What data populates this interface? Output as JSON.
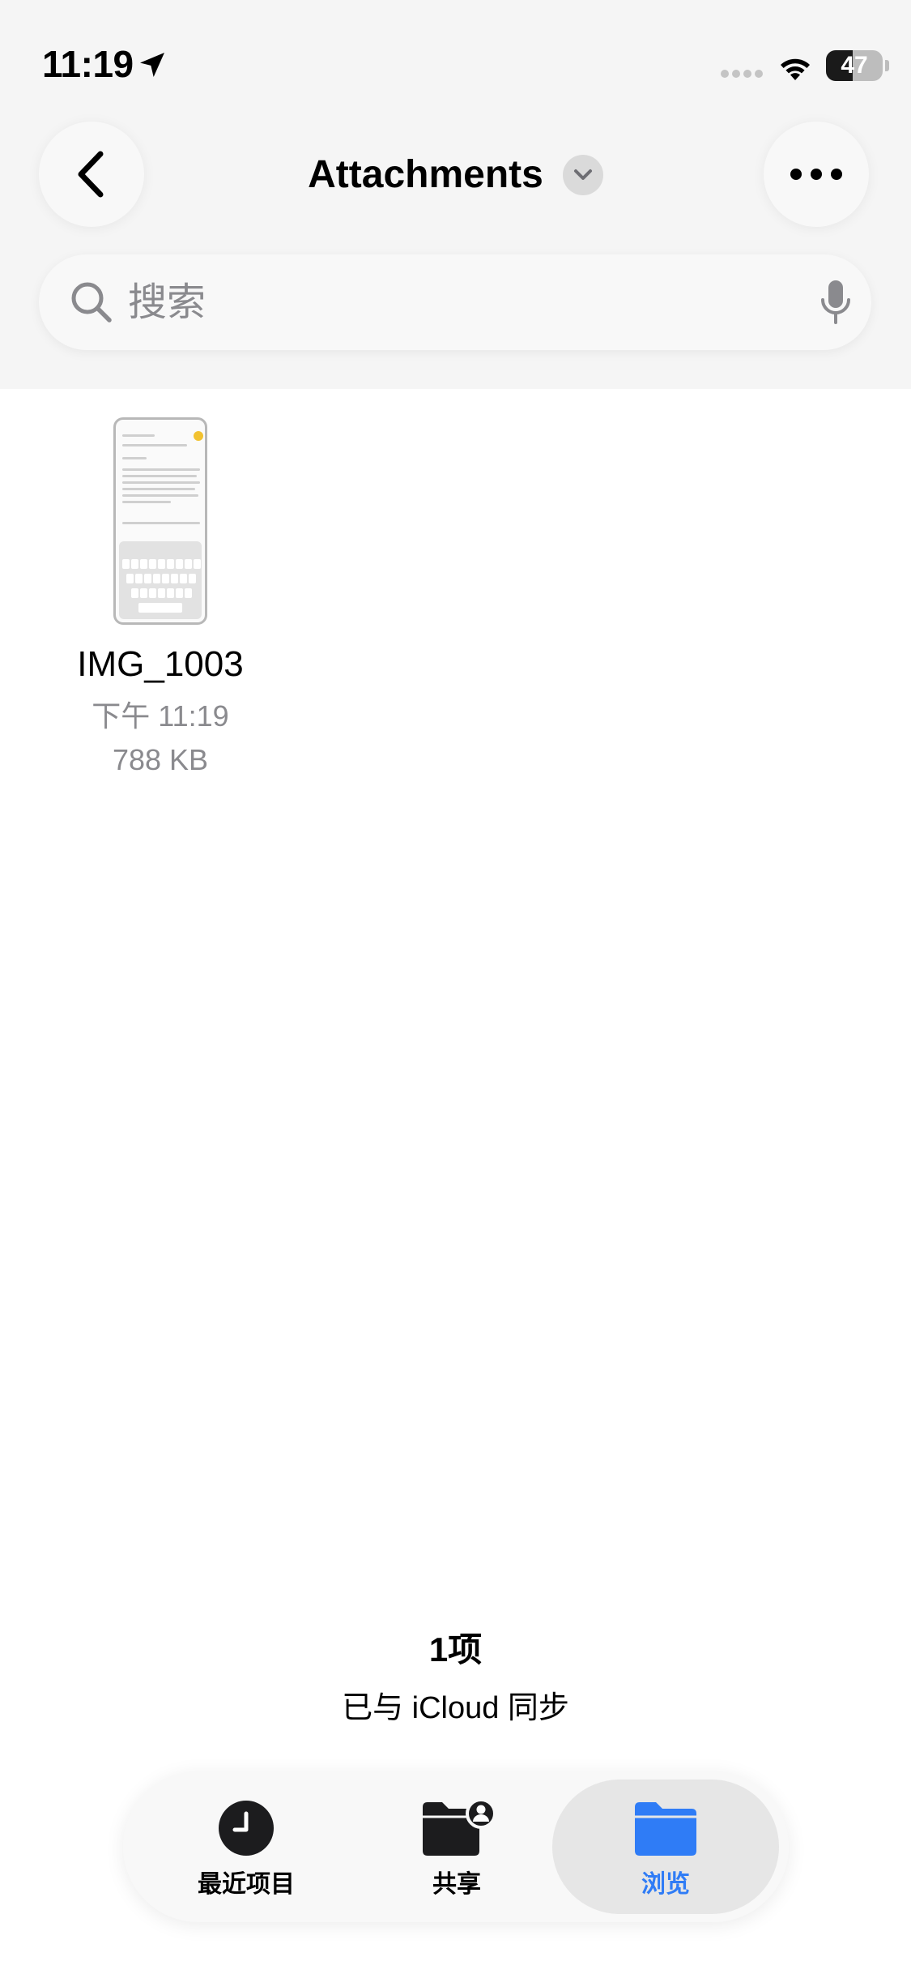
{
  "status_bar": {
    "time": "11:19",
    "battery": "47",
    "battery_level": 0.47
  },
  "header": {
    "title": "Attachments",
    "back_icon": "chevron-left-icon",
    "more_icon": "ellipsis-icon"
  },
  "search": {
    "placeholder": "搜索"
  },
  "files": [
    {
      "name": "IMG_1003",
      "date": "下午 11:19",
      "size": "788 KB"
    }
  ],
  "footer": {
    "count": "1项",
    "sync": "已与 iCloud 同步"
  },
  "tabs": [
    {
      "label": "最近项目",
      "icon": "clock-icon",
      "active": false
    },
    {
      "label": "共享",
      "icon": "shared-folder-icon",
      "active": false
    },
    {
      "label": "浏览",
      "icon": "folder-icon",
      "active": true
    }
  ],
  "colors": {
    "accent": "#2f7cf6",
    "secondary_text": "#8a8a8e"
  }
}
